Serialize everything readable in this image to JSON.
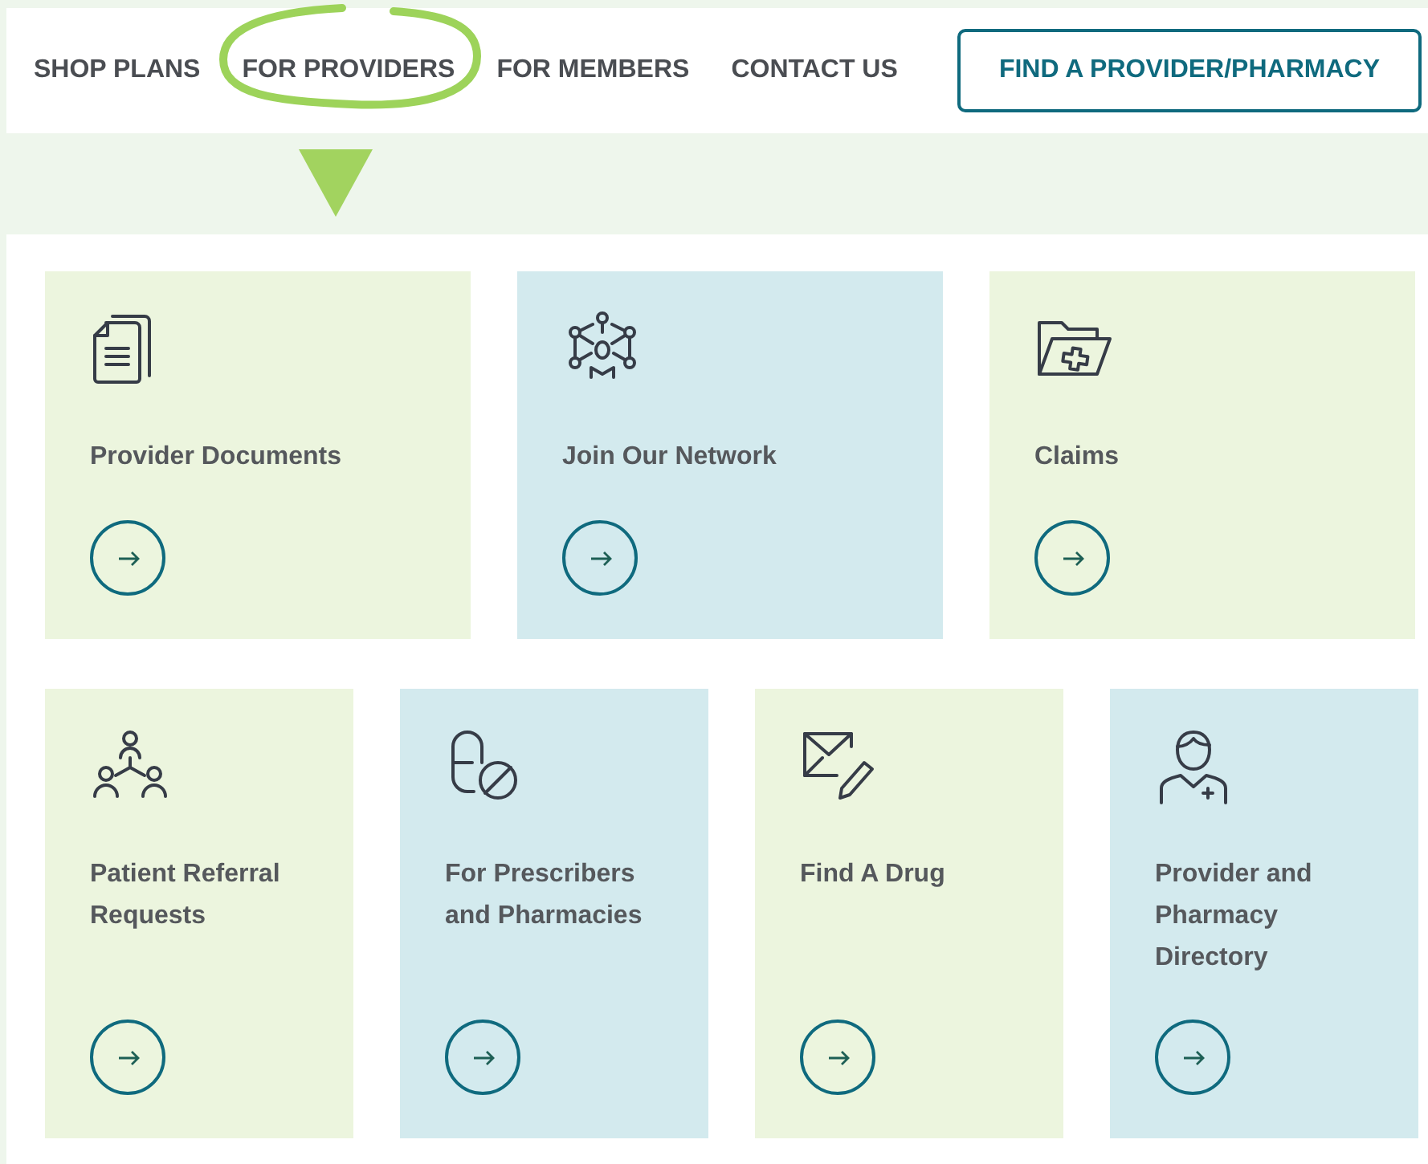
{
  "nav": {
    "items": [
      {
        "label": "SHOP PLANS",
        "selected": false
      },
      {
        "label": "FOR PROVIDERS",
        "selected": true
      },
      {
        "label": "FOR MEMBERS",
        "selected": false
      },
      {
        "label": "CONTACT US",
        "selected": false
      }
    ],
    "cta": "FIND A PROVIDER/PHARMACY"
  },
  "rows": [
    [
      {
        "title": "Provider Documents",
        "kind": "documents",
        "color": "#ecf5de"
      },
      {
        "title": "Join Our Network",
        "kind": "network",
        "color": "#d3eaee"
      },
      {
        "title": "Claims",
        "kind": "folder",
        "color": "#ecf5de"
      }
    ],
    [
      {
        "title": "Patient Referral Requests",
        "kind": "referral",
        "color": "#ecf5de"
      },
      {
        "title": "For Prescribers and Pharmacies",
        "kind": "pill",
        "color": "#d3eaee"
      },
      {
        "title": "Find A Drug",
        "kind": "mail",
        "color": "#ecf5de"
      },
      {
        "title": "Provider and Pharmacy Directory",
        "kind": "doctor",
        "color": "#d3eaee"
      }
    ]
  ]
}
